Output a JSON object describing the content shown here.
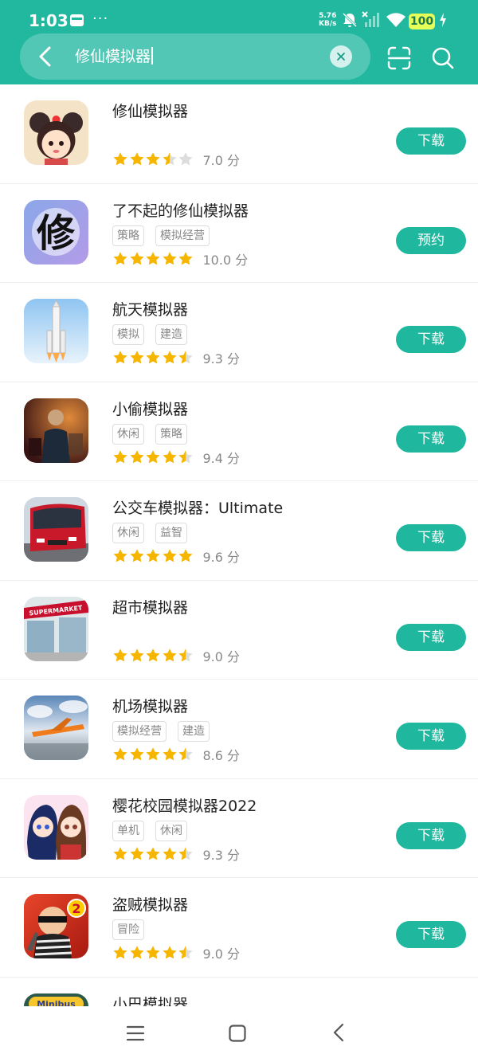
{
  "status_bar": {
    "time": "1:03",
    "dots": "···",
    "net_speed_value": "5.76",
    "net_speed_unit": "KB/s",
    "battery": "100"
  },
  "search": {
    "query": "修仙模拟器"
  },
  "apps": [
    {
      "name": "修仙模拟器",
      "tags": [],
      "stars": 3.5,
      "score": "7.0 分",
      "action": "下载",
      "icon": "xiuxian-icon"
    },
    {
      "name": "了不起的修仙模拟器",
      "tags": [
        "策略",
        "模拟经营"
      ],
      "stars": 5,
      "score": "10.0 分",
      "action": "预约",
      "icon": "calligraphy-icon"
    },
    {
      "name": "航天模拟器",
      "tags": [
        "模拟",
        "建造"
      ],
      "stars": 4.5,
      "score": "9.3 分",
      "action": "下载",
      "icon": "rocket-icon"
    },
    {
      "name": "小偷模拟器",
      "tags": [
        "休闲",
        "策略"
      ],
      "stars": 4.5,
      "score": "9.4 分",
      "action": "下载",
      "icon": "thief-icon"
    },
    {
      "name": "公交车模拟器：Ultimate",
      "tags": [
        "休闲",
        "益智"
      ],
      "stars": 5,
      "score": "9.6 分",
      "action": "下载",
      "icon": "bus-icon"
    },
    {
      "name": "超市模拟器",
      "tags": [],
      "stars": 4.5,
      "score": "9.0 分",
      "action": "下载",
      "icon": "supermarket-icon"
    },
    {
      "name": "机场模拟器",
      "tags": [
        "模拟经营",
        "建造"
      ],
      "stars": 4.5,
      "score": "8.6 分",
      "action": "下载",
      "icon": "airplane-icon"
    },
    {
      "name": "樱花校园模拟器2022",
      "tags": [
        "单机",
        "休闲"
      ],
      "stars": 4.5,
      "score": "9.3 分",
      "action": "下载",
      "icon": "anime-girls-icon"
    },
    {
      "name": "盗贼模拟器",
      "tags": [
        "冒险"
      ],
      "stars": 4.5,
      "score": "9.0 分",
      "action": "下载",
      "icon": "robber-icon"
    },
    {
      "name": "小巴模拟器",
      "tags": [],
      "stars": 0,
      "score": "",
      "action": "",
      "icon": "minibus-icon"
    }
  ],
  "icon_texts": {
    "xiu": "修",
    "supermarket": "SUPERMARKET",
    "two": "2",
    "minibus": "Minibus"
  },
  "colors": {
    "brand": "#22b8a0",
    "button": "#1fb89f",
    "star": "#f6b600",
    "star_empty": "#dddddd"
  }
}
